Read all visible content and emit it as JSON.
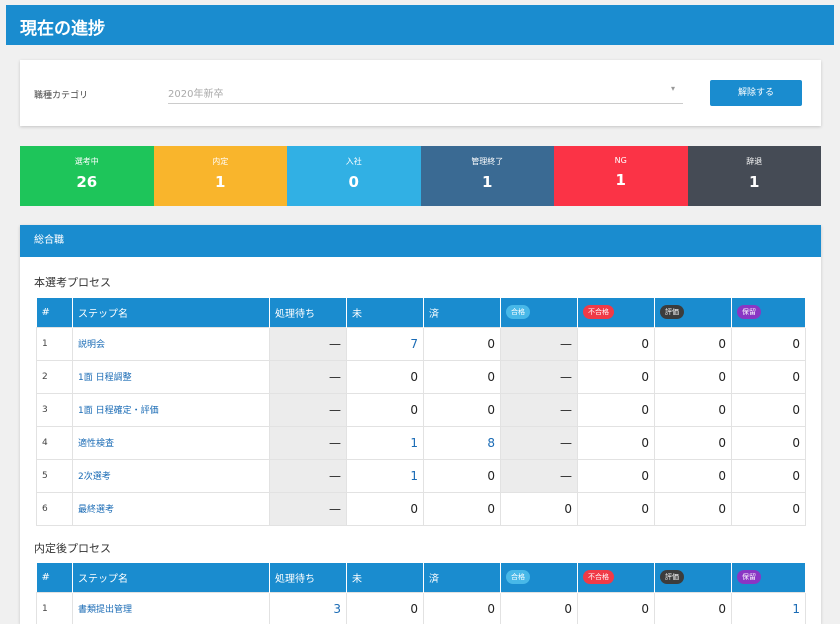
{
  "header": {
    "title": "現在の進捗"
  },
  "filter": {
    "label": "職種カテゴリ",
    "value": "2020年新卒",
    "caret": "▾",
    "button": "解除する"
  },
  "stats": [
    {
      "label": "選考中",
      "value": "26",
      "color": "#1ec55a"
    },
    {
      "label": "内定",
      "value": "1",
      "color": "#f9b52c"
    },
    {
      "label": "入社",
      "value": "0",
      "color": "#31b0e4"
    },
    {
      "label": "管理終了",
      "value": "1",
      "color": "#3a6a93"
    },
    {
      "label": "NG",
      "value": "1",
      "color": "#fb3346"
    },
    {
      "label": "辞退",
      "value": "1",
      "color": "#454b55"
    }
  ],
  "section": {
    "title": "総合職"
  },
  "process1": {
    "title": "本選考プロセス"
  },
  "process2": {
    "title": "内定後プロセス"
  },
  "columns": {
    "idx": "#",
    "name": "ステップ名",
    "waiting": "処理待ち",
    "pending": "未",
    "done": "済",
    "pass": "合格",
    "fail": "不合格",
    "eval": "評価",
    "hold": "保留"
  },
  "badge_colors": {
    "pass": "#48b8e8",
    "fail": "#f03a47",
    "eval": "#3c3c3c",
    "hold": "#8a36c4"
  },
  "table1": [
    {
      "idx": "1",
      "name": "説明会",
      "waiting": "—",
      "pending": "7",
      "done": "0",
      "pass": "—",
      "fail": "0",
      "eval": "0",
      "hold": "0"
    },
    {
      "idx": "2",
      "name": "1面 日程調整",
      "waiting": "—",
      "pending": "0",
      "done": "0",
      "pass": "—",
      "fail": "0",
      "eval": "0",
      "hold": "0"
    },
    {
      "idx": "3",
      "name": "1面 日程確定・評価",
      "waiting": "—",
      "pending": "0",
      "done": "0",
      "pass": "—",
      "fail": "0",
      "eval": "0",
      "hold": "0"
    },
    {
      "idx": "4",
      "name": "適性検査",
      "waiting": "—",
      "pending": "1",
      "done": "8",
      "pass": "—",
      "fail": "0",
      "eval": "0",
      "hold": "0"
    },
    {
      "idx": "5",
      "name": "2次選考",
      "waiting": "—",
      "pending": "1",
      "done": "0",
      "pass": "—",
      "fail": "0",
      "eval": "0",
      "hold": "0"
    },
    {
      "idx": "6",
      "name": "最終選考",
      "waiting": "—",
      "pending": "0",
      "done": "0",
      "pass": "0",
      "fail": "0",
      "eval": "0",
      "hold": "0"
    }
  ],
  "table2": [
    {
      "idx": "1",
      "name": "書類提出管理",
      "waiting": "3",
      "pending": "0",
      "done": "0",
      "pass": "0",
      "fail": "0",
      "eval": "0",
      "hold": "1"
    }
  ]
}
